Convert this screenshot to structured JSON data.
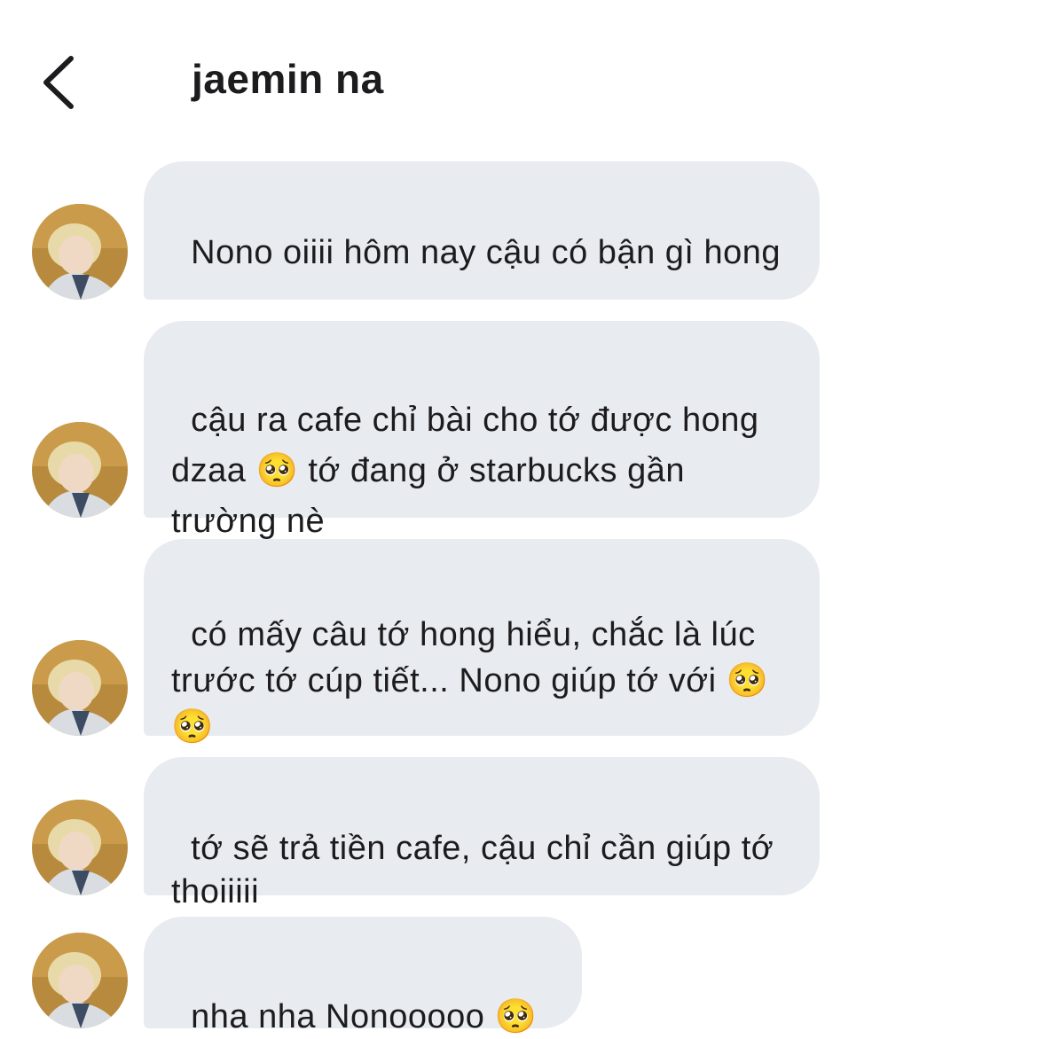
{
  "header": {
    "back_icon": "chevron-left-icon",
    "title": "jaemin na"
  },
  "messages": [
    {
      "text": "Nono oiiii hôm nay cậu có bận gì hong"
    },
    {
      "text": "cậu ra cafe chỉ bài cho tớ được hong dzaa 🥺 tớ đang ở starbucks gần trường nè"
    },
    {
      "text": "có mấy câu tớ hong hiểu, chắc là lúc trước tớ cúp tiết... Nono giúp tớ với 🥺 🥺"
    },
    {
      "text": "tớ sẽ trả tiền cafe, cậu chỉ cần giúp tớ thoiiiii"
    },
    {
      "text": "nha nha Nonooooo 🥺"
    }
  ],
  "colors": {
    "bubble_background": "#e8ebf0",
    "text": "#1c1c1e",
    "background": "#ffffff"
  }
}
